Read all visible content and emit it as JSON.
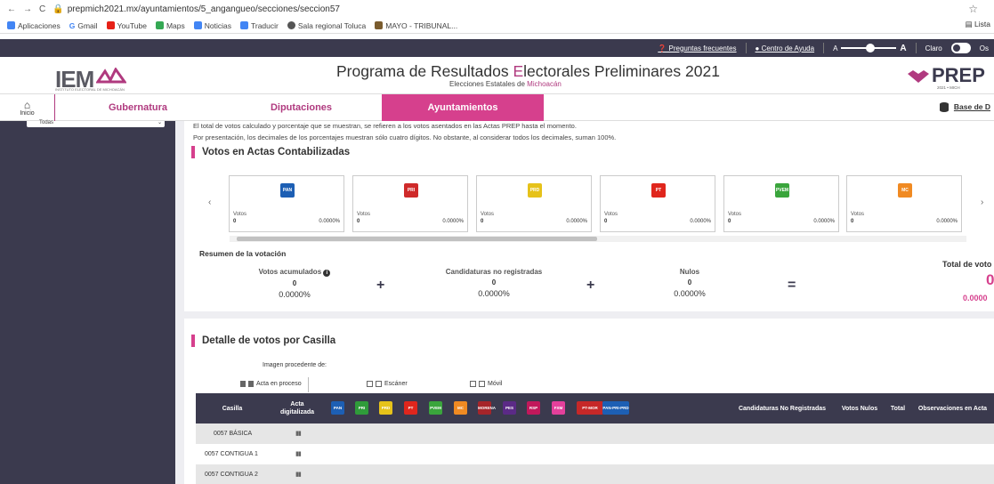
{
  "browser": {
    "url": "prepmich2021.mx/ayuntamientos/5_angangueo/secciones/seccion57",
    "bookmarks": [
      "Aplicaciones",
      "Gmail",
      "YouTube",
      "Maps",
      "Noticias",
      "Traducir",
      "Sala regional Toluca",
      "MAYO - TRIBUNAL..."
    ],
    "reading_list": "Lista"
  },
  "topbar": {
    "faq": "Preguntas frecuentes",
    "help": "Centro de Ayuda",
    "font_small": "A",
    "font_large": "A",
    "theme": "Claro",
    "theme_dark": "Os"
  },
  "header": {
    "logo": "IEM",
    "logo_sub": "INSTITUTO ELECTORAL DE MICHOACÁN",
    "title_pre": "Programa de Resultados ",
    "title_hl": "E",
    "title_post": "lectorales Preliminares 2021",
    "subtitle_pre": "Elecciones Estatales de ",
    "subtitle_hl": "Michoacán",
    "prep": "PREP",
    "prep_sub": "2021 • MICH"
  },
  "nav": {
    "home": "Inicio",
    "tabs": [
      "Gubernatura",
      "Diputaciones",
      "Ayuntamientos"
    ],
    "base": "Base de D"
  },
  "sidebar": {
    "select": "Todas"
  },
  "notes": {
    "line1": "El total de votos calculado y porcentaje que se muestran, se refieren a los votos asentados en las Actas PREP hasta el momento.",
    "line2": "Por presentación, los decimales de los porcentajes muestran sólo cuatro dígitos. No obstante, al considerar todos los decimales, suman 100%."
  },
  "section1": {
    "title": "Votos en Actas Contabilizadas"
  },
  "cards": [
    {
      "logo": "PAN",
      "color": "#1d5fb4",
      "label": "Votos",
      "value": "0",
      "pct": "0.0000%"
    },
    {
      "logo": "PRI",
      "color": "#cf2a2a",
      "label": "Votos",
      "value": "0",
      "pct": "0.0000%"
    },
    {
      "logo": "PRD",
      "color": "#e6c21a",
      "label": "Votos",
      "value": "0",
      "pct": "0.0000%"
    },
    {
      "logo": "PT",
      "color": "#e0261d",
      "label": "Votos",
      "value": "0",
      "pct": "0.0000%"
    },
    {
      "logo": "PVEM",
      "color": "#3aa53c",
      "label": "Votos",
      "value": "0",
      "pct": "0.0000%"
    },
    {
      "logo": "MC",
      "color": "#f08a22",
      "label": "Votos",
      "value": "0",
      "pct": "0.0000%"
    }
  ],
  "resumen": {
    "title": "Resumen de la votación",
    "acumulados_label": "Votos acumulados",
    "acumulados_value": "0",
    "acumulados_pct": "0.0000%",
    "no_reg_label": "Candidaturas no registradas",
    "no_reg_value": "0",
    "no_reg_pct": "0.0000%",
    "nulos_label": "Nulos",
    "nulos_value": "0",
    "nulos_pct": "0.0000%",
    "plus": "+",
    "equals": "=",
    "total_label": "Total de voto",
    "total_value": "0",
    "total_pct": "0.0000"
  },
  "section2": {
    "title": "Detalle de votos por Casilla",
    "image_origin": "Imagen procedente de:",
    "legend": [
      "Acta en proceso",
      "Escáner",
      "Móvil"
    ]
  },
  "table": {
    "headers": {
      "casilla": "Casilla",
      "acta_1": "Acta",
      "acta_2": "digitalizada",
      "no_reg": "Candidaturas No Registradas",
      "nulos": "Votos Nulos",
      "total": "Total",
      "obs": "Observaciones en Acta"
    },
    "party_logos": [
      {
        "name": "PAN",
        "color": "#1d5fb4"
      },
      {
        "name": "PRI",
        "color": "#2f9c3a"
      },
      {
        "name": "PRD",
        "color": "#e6c21a"
      },
      {
        "name": "PT",
        "color": "#e0261d"
      },
      {
        "name": "PVEM",
        "color": "#3aa53c"
      },
      {
        "name": "MC",
        "color": "#f08a22"
      },
      {
        "name": "MORENA",
        "color": "#a6252a"
      },
      {
        "name": "PES",
        "color": "#5b2a86"
      },
      {
        "name": "RSP",
        "color": "#c2185b"
      },
      {
        "name": "FXM",
        "color": "#e4409b"
      },
      {
        "name": "PT-MOR",
        "color": "#c62828"
      },
      {
        "name": "PAN-PRI-PRD",
        "color": "#1d5fb4"
      }
    ],
    "rows": [
      {
        "casilla": "0057 BÁSICA",
        "acta": "▮▮"
      },
      {
        "casilla": "0057 CONTIGUA 1",
        "acta": "▮▮"
      },
      {
        "casilla": "0057 CONTIGUA 2",
        "acta": "▮▮"
      }
    ]
  }
}
